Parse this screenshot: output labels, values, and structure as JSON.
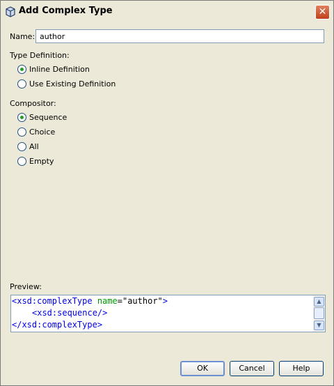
{
  "window": {
    "title": "Add Complex Type"
  },
  "name": {
    "label": "Name:",
    "value": "author"
  },
  "type_definition": {
    "label": "Type Definition:",
    "options": [
      {
        "label": "Inline Definition",
        "selected": true
      },
      {
        "label": "Use Existing Definition",
        "selected": false
      }
    ]
  },
  "compositor": {
    "label": "Compositor:",
    "options": [
      {
        "label": "Sequence",
        "selected": true
      },
      {
        "label": "Choice",
        "selected": false
      },
      {
        "label": "All",
        "selected": false
      },
      {
        "label": "Empty",
        "selected": false
      }
    ]
  },
  "preview": {
    "label": "Preview:",
    "line1_open": "<xsd:complexType",
    "line1_attr": "name",
    "line1_eq": "=",
    "line1_val": "\"author\"",
    "line1_close": ">",
    "line2": "<xsd:sequence/>",
    "line3": "</xsd:complexType>"
  },
  "buttons": {
    "ok": "OK",
    "cancel": "Cancel",
    "help": "Help"
  },
  "icons": {
    "title": "cube-icon",
    "close": "close-icon",
    "scroll_up": "arrow-up-icon",
    "scroll_down": "arrow-down-icon"
  }
}
